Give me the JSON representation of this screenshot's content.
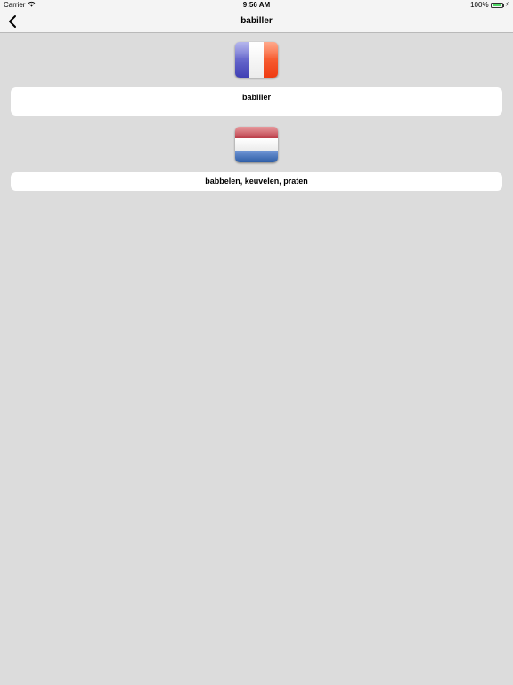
{
  "status_bar": {
    "carrier": "Carrier",
    "time": "9:56 AM",
    "battery": "100%",
    "battery_color": "#4cd964"
  },
  "nav": {
    "title": "babiller",
    "back_icon": "chevron-left-icon"
  },
  "entries": [
    {
      "flag": "france-flag-icon",
      "text": "babiller"
    },
    {
      "flag": "netherlands-flag-icon",
      "text": "babbelen, keuvelen, praten"
    }
  ],
  "colors": {
    "background": "#dcdcdc",
    "bar": "#f4f4f4",
    "card": "#ffffff"
  }
}
